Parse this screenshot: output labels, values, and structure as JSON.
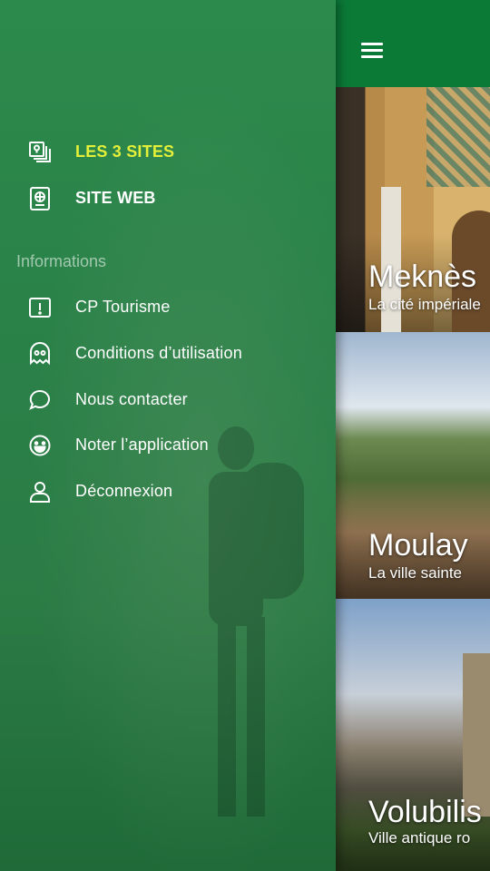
{
  "drawer": {
    "primary_items": [
      {
        "label": "LES 3 SITES",
        "icon": "map-pages-icon",
        "active": true
      },
      {
        "label": "SITE WEB",
        "icon": "passport-icon",
        "active": false
      }
    ],
    "section_header": "Informations",
    "info_items": [
      {
        "label": "CP Tourisme",
        "icon": "alert-box-icon"
      },
      {
        "label": "Conditions d’utilisation",
        "icon": "ghost-icon"
      },
      {
        "label": "Nous contacter",
        "icon": "chat-bubble-icon"
      },
      {
        "label": "Noter l’application",
        "icon": "smiley-icon"
      },
      {
        "label": "Déconnexion",
        "icon": "user-icon"
      }
    ],
    "active_color": "#e4ef3a"
  },
  "app": {
    "menu_icon": "hamburger-menu-icon",
    "sites": [
      {
        "title": "Meknès",
        "subtitle": "La cité impériale"
      },
      {
        "title": "Moulay",
        "subtitle": "La ville sainte"
      },
      {
        "title": "Volubilis",
        "subtitle": "Ville antique ro"
      }
    ]
  }
}
